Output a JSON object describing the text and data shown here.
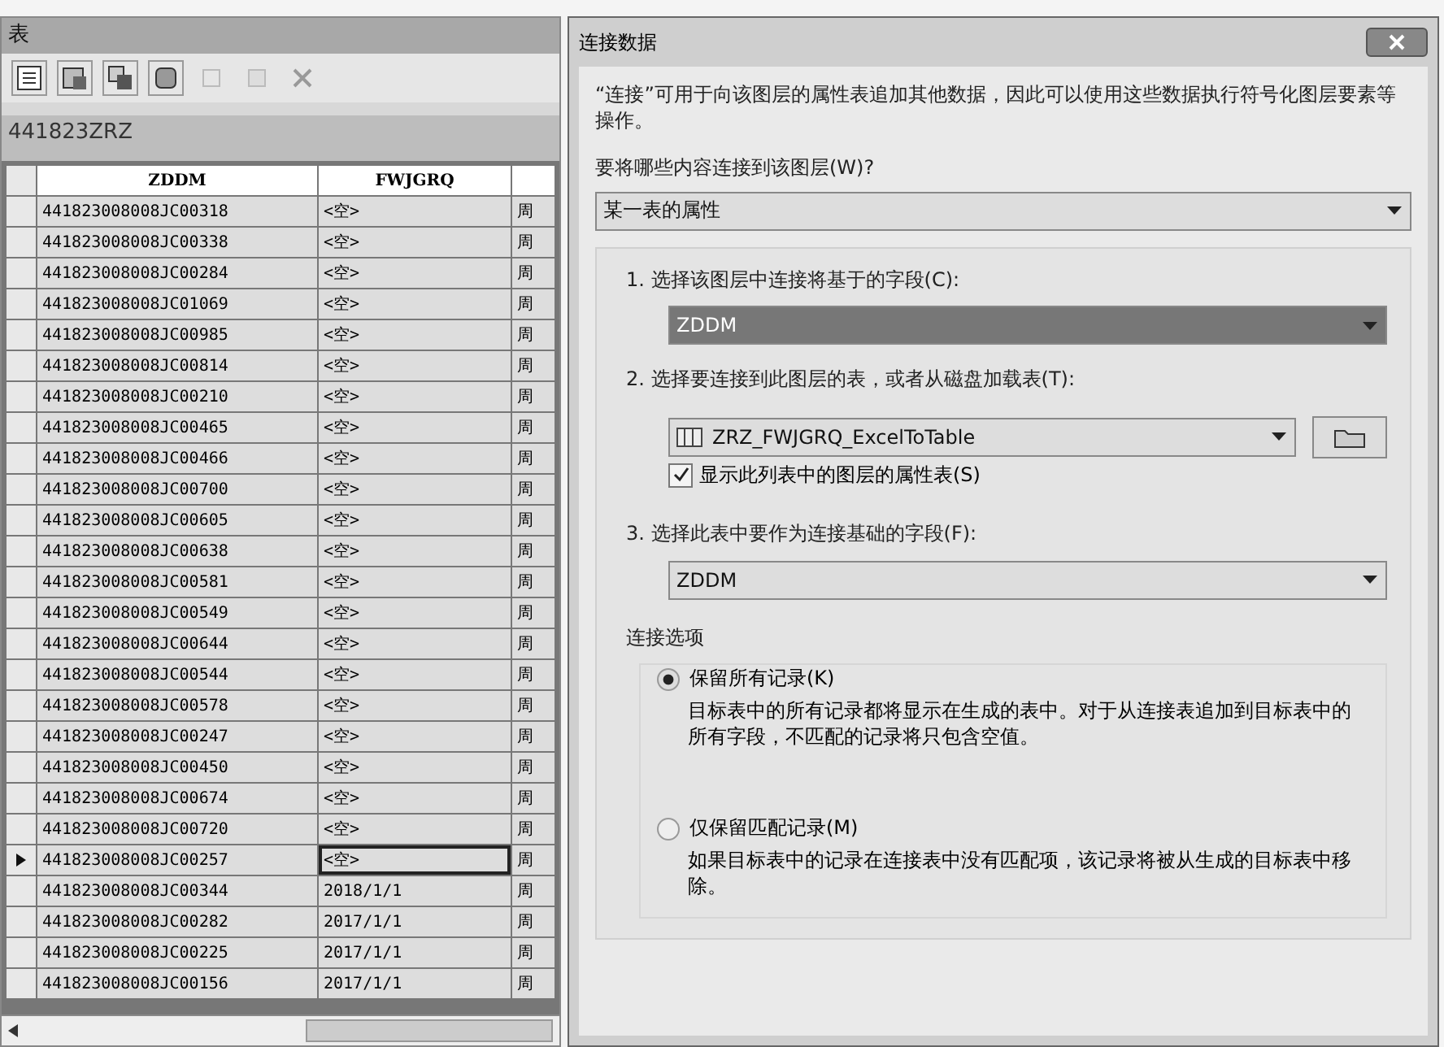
{
  "table_window": {
    "title": "表",
    "layer_name": "441823ZRZ",
    "columns": [
      "ZDDM",
      "FWJGRQ"
    ],
    "rows": [
      {
        "zddm": "441823008008JC00318",
        "fwjgrq": "<空>",
        "column_3": "周",
        "current": false
      },
      {
        "zddm": "441823008008JC00338",
        "fwjgrq": "<空>",
        "column_3": "周",
        "current": false
      },
      {
        "zddm": "441823008008JC00284",
        "fwjgrq": "<空>",
        "column_3": "周",
        "current": false
      },
      {
        "zddm": "441823008008JC01069",
        "fwjgrq": "<空>",
        "column_3": "周",
        "current": false
      },
      {
        "zddm": "441823008008JC00985",
        "fwjgrq": "<空>",
        "column_3": "周",
        "current": false
      },
      {
        "zddm": "441823008008JC00814",
        "fwjgrq": "<空>",
        "column_3": "周",
        "current": false
      },
      {
        "zddm": "441823008008JC00210",
        "fwjgrq": "<空>",
        "column_3": "周",
        "current": false
      },
      {
        "zddm": "441823008008JC00465",
        "fwjgrq": "<空>",
        "column_3": "周",
        "current": false
      },
      {
        "zddm": "441823008008JC00466",
        "fwjgrq": "<空>",
        "column_3": "周",
        "current": false
      },
      {
        "zddm": "441823008008JC00700",
        "fwjgrq": "<空>",
        "column_3": "周",
        "current": false
      },
      {
        "zddm": "441823008008JC00605",
        "fwjgrq": "<空>",
        "column_3": "周",
        "current": false
      },
      {
        "zddm": "441823008008JC00638",
        "fwjgrq": "<空>",
        "column_3": "周",
        "current": false
      },
      {
        "zddm": "441823008008JC00581",
        "fwjgrq": "<空>",
        "column_3": "周",
        "current": false
      },
      {
        "zddm": "441823008008JC00549",
        "fwjgrq": "<空>",
        "column_3": "周",
        "current": false
      },
      {
        "zddm": "441823008008JC00644",
        "fwjgrq": "<空>",
        "column_3": "周",
        "current": false
      },
      {
        "zddm": "441823008008JC00544",
        "fwjgrq": "<空>",
        "column_3": "周",
        "current": false
      },
      {
        "zddm": "441823008008JC00578",
        "fwjgrq": "<空>",
        "column_3": "周",
        "current": false
      },
      {
        "zddm": "441823008008JC00247",
        "fwjgrq": "<空>",
        "column_3": "周",
        "current": false
      },
      {
        "zddm": "441823008008JC00450",
        "fwjgrq": "<空>",
        "column_3": "周",
        "current": false
      },
      {
        "zddm": "441823008008JC00674",
        "fwjgrq": "<空>",
        "column_3": "周",
        "current": false
      },
      {
        "zddm": "441823008008JC00720",
        "fwjgrq": "<空>",
        "column_3": "周",
        "current": false
      },
      {
        "zddm": "441823008008JC00257",
        "fwjgrq": "<空>",
        "column_3": "周",
        "current": true
      },
      {
        "zddm": "441823008008JC00344",
        "fwjgrq": "2018/1/1",
        "column_3": "周",
        "current": false
      },
      {
        "zddm": "441823008008JC00282",
        "fwjgrq": "2017/1/1",
        "column_3": "周",
        "current": false
      },
      {
        "zddm": "441823008008JC00225",
        "fwjgrq": "2017/1/1",
        "column_3": "周",
        "current": false
      },
      {
        "zddm": "441823008008JC00156",
        "fwjgrq": "2017/1/1",
        "column_3": "周",
        "current": false
      }
    ]
  },
  "dialog": {
    "title": "连接数据",
    "intro": "“连接”可用于向该图层的属性表追加其他数据，因此可以使用这些数据执行符号化图层要素等操作。",
    "what_label": "要将哪些内容连接到该图层(W)?",
    "what_value": "某一表的属性",
    "step1_label": "1. 选择该图层中连接将基于的字段(C):",
    "step1_value": "ZDDM",
    "step2_label": "2. 选择要连接到此图层的表，或者从磁盘加载表(T):",
    "step2_value": "ZRZ_FWJGRQ_ExcelToTable",
    "show_layers": {
      "label": "显示此列表中的图层的属性表(S)",
      "checked": true
    },
    "step3_label": "3. 选择此表中要作为连接基础的字段(F):",
    "step3_value": "ZDDM",
    "options_title": "连接选项",
    "options": [
      {
        "label": "保留所有记录(K)",
        "description": "目标表中的所有记录都将显示在生成的表中。对于从连接表追加到目标表中的所有字段，不匹配的记录将只包含空值。",
        "selected": true
      },
      {
        "label": "仅保留匹配记录(M)",
        "description": "如果目标表中的记录在连接表中没有匹配项，该记录将被从生成的目标表中移除。",
        "selected": false
      }
    ]
  }
}
